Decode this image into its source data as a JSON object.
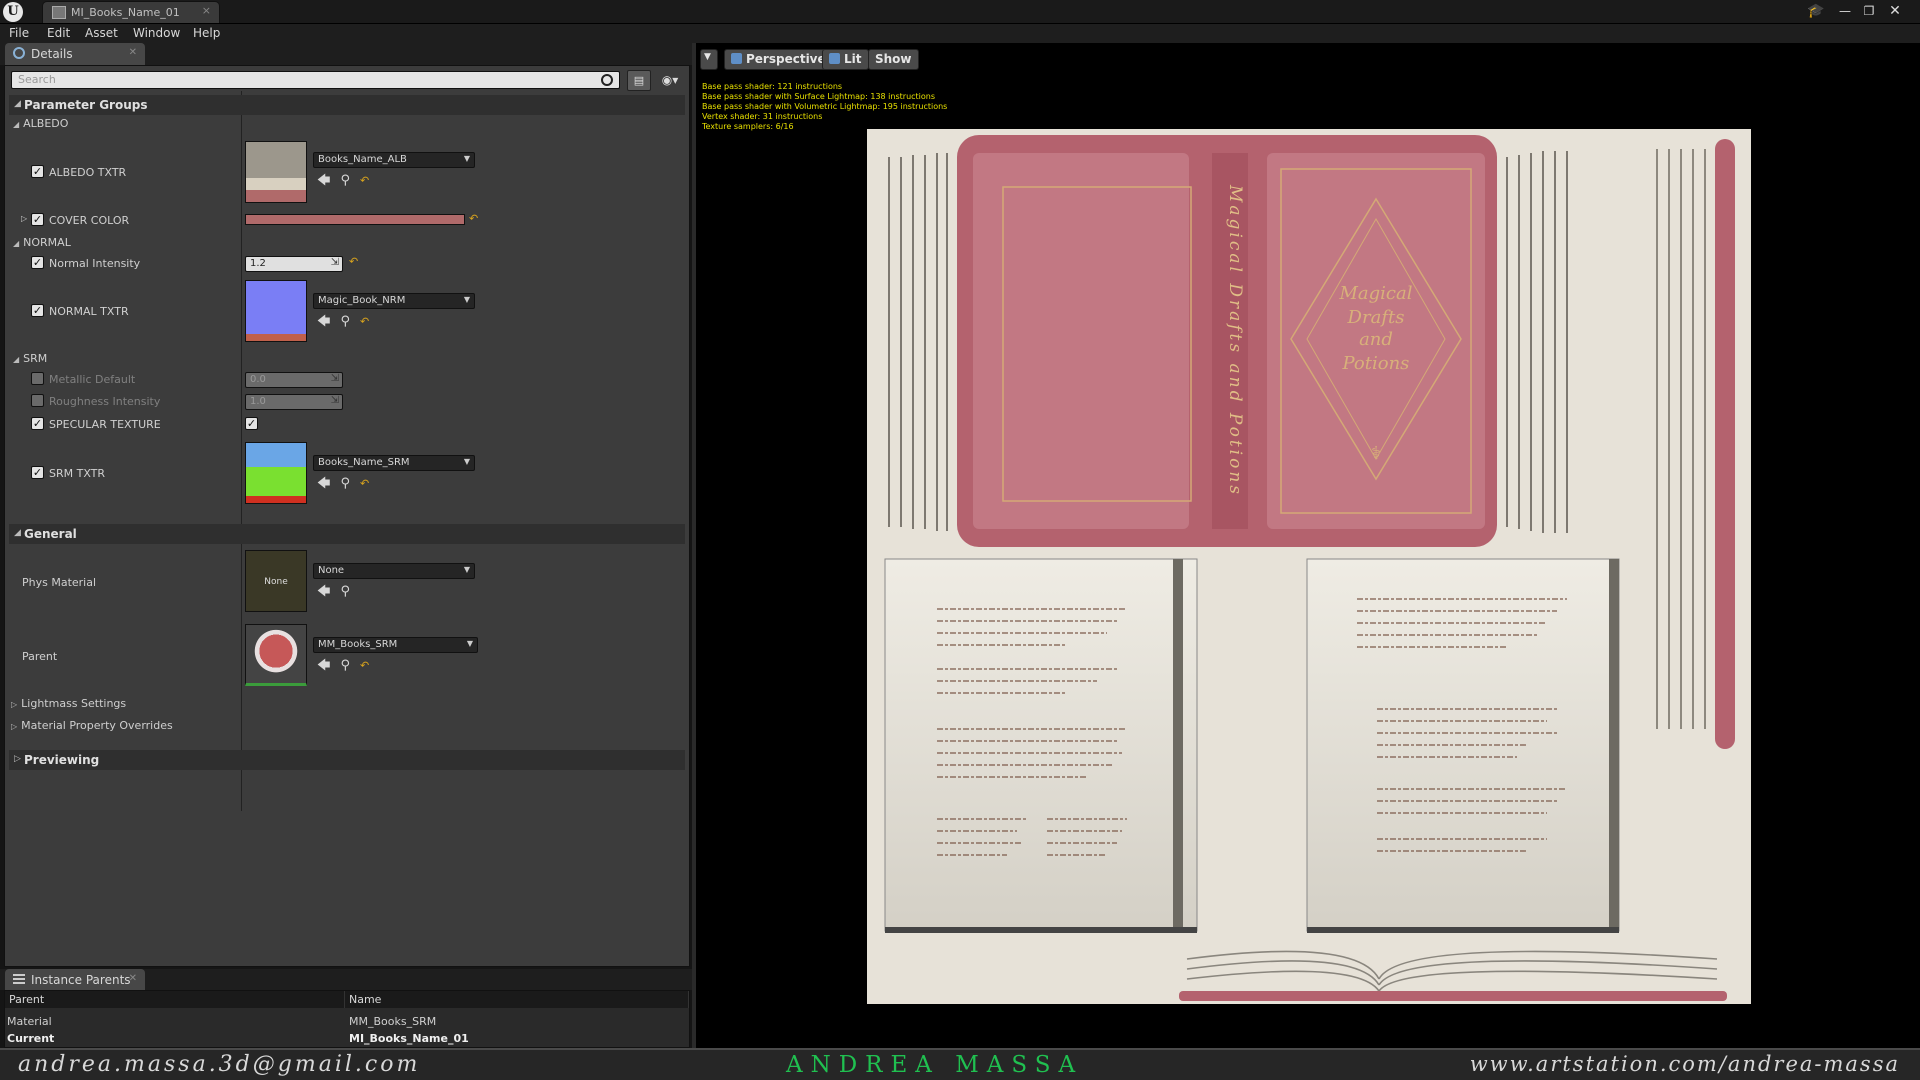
{
  "window": {
    "tab_label": "MI_Books_Name_01",
    "tab_close": "×",
    "help_icon": "graduation-cap-icon",
    "min": "—",
    "max": "❐",
    "close": "✕"
  },
  "menu": [
    "File",
    "Edit",
    "Asset",
    "Window",
    "Help"
  ],
  "details": {
    "tab_label": "Details",
    "search_placeholder": "Search",
    "sections": {
      "parameter_groups": "Parameter Groups",
      "general": "General",
      "previewing": "Previewing"
    },
    "albedo": {
      "group": "ALBEDO",
      "albedo_txtr": {
        "label": "ALBEDO TXTR",
        "value": "Books_Name_ALB"
      },
      "cover_color": {
        "label": "COVER COLOR",
        "color": "#b06a6a"
      }
    },
    "normal": {
      "group": "NORMAL",
      "normal_intensity": {
        "label": "Normal Intensity",
        "value": "1.2"
      },
      "normal_txtr": {
        "label": "NORMAL TXTR",
        "value": "Magic_Book_NRM"
      }
    },
    "srm": {
      "group": "SRM",
      "metallic_default": {
        "label": "Metallic Default",
        "value": "0.0"
      },
      "roughness_intensity": {
        "label": "Roughness Intensity",
        "value": "1.0"
      },
      "specular_texture": {
        "label": "SPECULAR TEXTURE"
      },
      "srm_txtr": {
        "label": "SRM TXTR",
        "value": "Books_Name_SRM"
      }
    },
    "general": {
      "phys_material": {
        "label": "Phys Material",
        "value": "None",
        "thumb_text": "None"
      },
      "parent": {
        "label": "Parent",
        "value": "MM_Books_SRM"
      },
      "lightmass": "Lightmass Settings",
      "overrides": "Material Property Overrides"
    }
  },
  "instance_parents": {
    "tab_label": "Instance Parents",
    "columns": [
      "Parent",
      "Name"
    ],
    "rows": [
      {
        "parent": "Material",
        "name": "MM_Books_SRM"
      },
      {
        "parent": "Current",
        "name": "MI_Books_Name_01"
      }
    ]
  },
  "viewport": {
    "perspective": "Perspective",
    "lit": "Lit",
    "show": "Show",
    "stats": [
      "Base pass shader: 121 instructions",
      "Base pass shader with Surface Lightmap: 138 instructions",
      "Base pass shader with Volumetric Lightmap: 195 instructions",
      "Vertex shader: 31 instructions",
      "Texture samplers: 6/16"
    ],
    "cover_title": [
      "Magical",
      "Drafts",
      "and",
      "Potions"
    ],
    "spine_title": "Magical Drafts and Potions"
  },
  "footer": {
    "email": "andrea.massa.3d@gmail.com",
    "name": "ANDREA MASSA",
    "url": "www.artstation.com/andrea-massa"
  }
}
